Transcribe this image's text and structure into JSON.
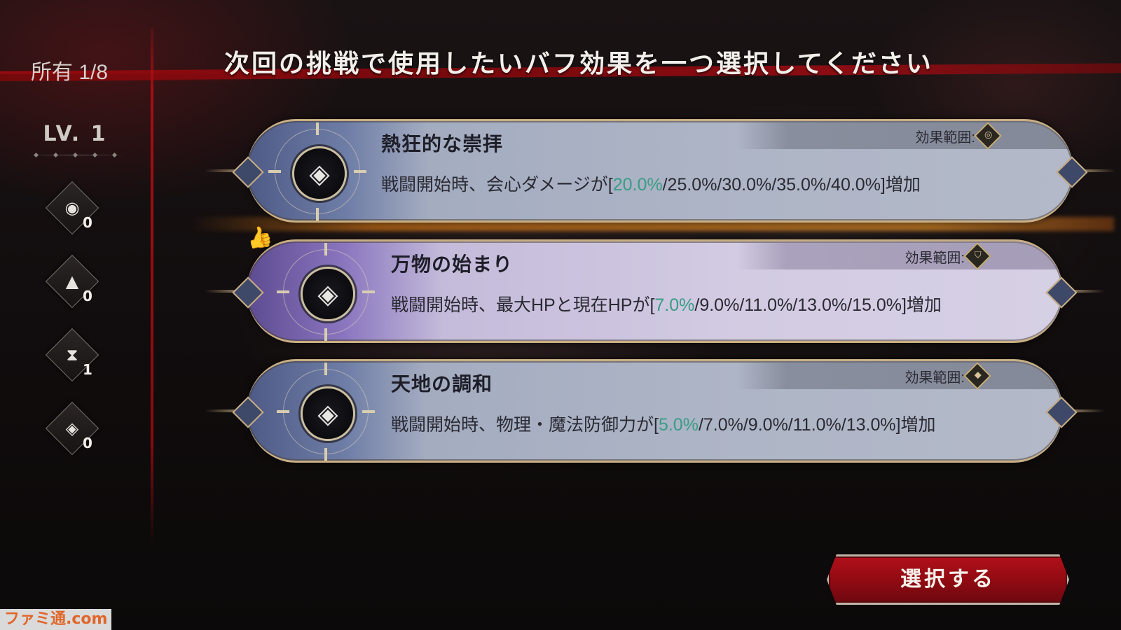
{
  "header": {
    "owned_label": "所有 1/8",
    "title": "次回の挑戦で使用したいバフ効果を一つ選択してください"
  },
  "sidebar": {
    "level": "LV. 1",
    "resources": [
      {
        "icon": "orb-icon",
        "glyph": "◉",
        "count": "0"
      },
      {
        "icon": "pyramid-icon",
        "glyph": "▲",
        "count": "0"
      },
      {
        "icon": "hourglass-icon",
        "glyph": "⧗",
        "count": "1"
      },
      {
        "icon": "crystal-icon",
        "glyph": "◈",
        "count": "0"
      }
    ]
  },
  "cards": [
    {
      "name": "熱狂的な崇拝",
      "range_label": "効果範囲:",
      "range_icon": "range-circle-icon",
      "desc_prefix": "戦闘開始時、会心ダメージが[",
      "desc_highlight": "20.0%",
      "desc_suffix": "/25.0%/30.0%/35.0%/40.0%]増加",
      "theme": "blue",
      "selected": true
    },
    {
      "name": "万物の始まり",
      "range_label": "効果範囲:",
      "range_icon": "range-shield-icon",
      "desc_prefix": "戦闘開始時、最大HPと現在HPが[",
      "desc_highlight": "7.0%",
      "desc_suffix": "/9.0%/11.0%/13.0%/15.0%]増加",
      "theme": "purple",
      "recommended": true
    },
    {
      "name": "天地の調和",
      "range_label": "効果範囲:",
      "range_icon": "range-diamond-icon",
      "desc_prefix": "戦闘開始時、物理・魔法防御力が[",
      "desc_highlight": "5.0%",
      "desc_suffix": "/7.0%/9.0%/11.0%/13.0%]増加",
      "theme": "blue"
    }
  ],
  "actions": {
    "select_label": "選択する"
  },
  "watermark": "ファミ通.com",
  "colors": {
    "accent_red": "#b2101a",
    "highlight_green": "#3a9c86",
    "frame_gold": "#c8ae83",
    "selected_glow": "#ff8c14"
  }
}
